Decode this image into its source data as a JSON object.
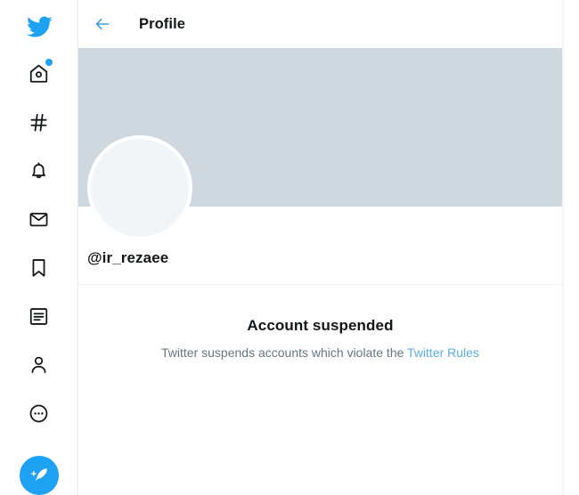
{
  "sidebar": {
    "logo": {
      "icon": "twitter-bird-logo",
      "color": "#1da1f2"
    },
    "items": [
      {
        "icon": "home-icon",
        "label": "Home",
        "has_badge": true
      },
      {
        "icon": "explore-hashtag-icon",
        "label": "Explore",
        "has_badge": false
      },
      {
        "icon": "notifications-bell-icon",
        "label": "Notifications",
        "has_badge": false
      },
      {
        "icon": "messages-envelope-icon",
        "label": "Messages",
        "has_badge": false
      },
      {
        "icon": "bookmarks-icon",
        "label": "Bookmarks",
        "has_badge": false
      },
      {
        "icon": "lists-icon",
        "label": "Lists",
        "has_badge": false
      },
      {
        "icon": "profile-person-icon",
        "label": "Profile",
        "has_badge": false
      },
      {
        "icon": "more-dots-circle-icon",
        "label": "More",
        "has_badge": false
      }
    ],
    "compose": {
      "icon": "compose-feather-icon",
      "label": "Tweet",
      "color": "#1da1f2"
    }
  },
  "header": {
    "back_icon": "back-arrow-icon",
    "title": "Profile"
  },
  "profile": {
    "banner_color": "#ced8de",
    "avatar_icon": "profile-avatar-placeholder",
    "handle": "@ir_rezaee"
  },
  "suspended": {
    "title": "Account suspended",
    "description_before": "Twitter suspends accounts which violate the ",
    "link_text": "Twitter Rules",
    "link_color": "#5daeea"
  }
}
